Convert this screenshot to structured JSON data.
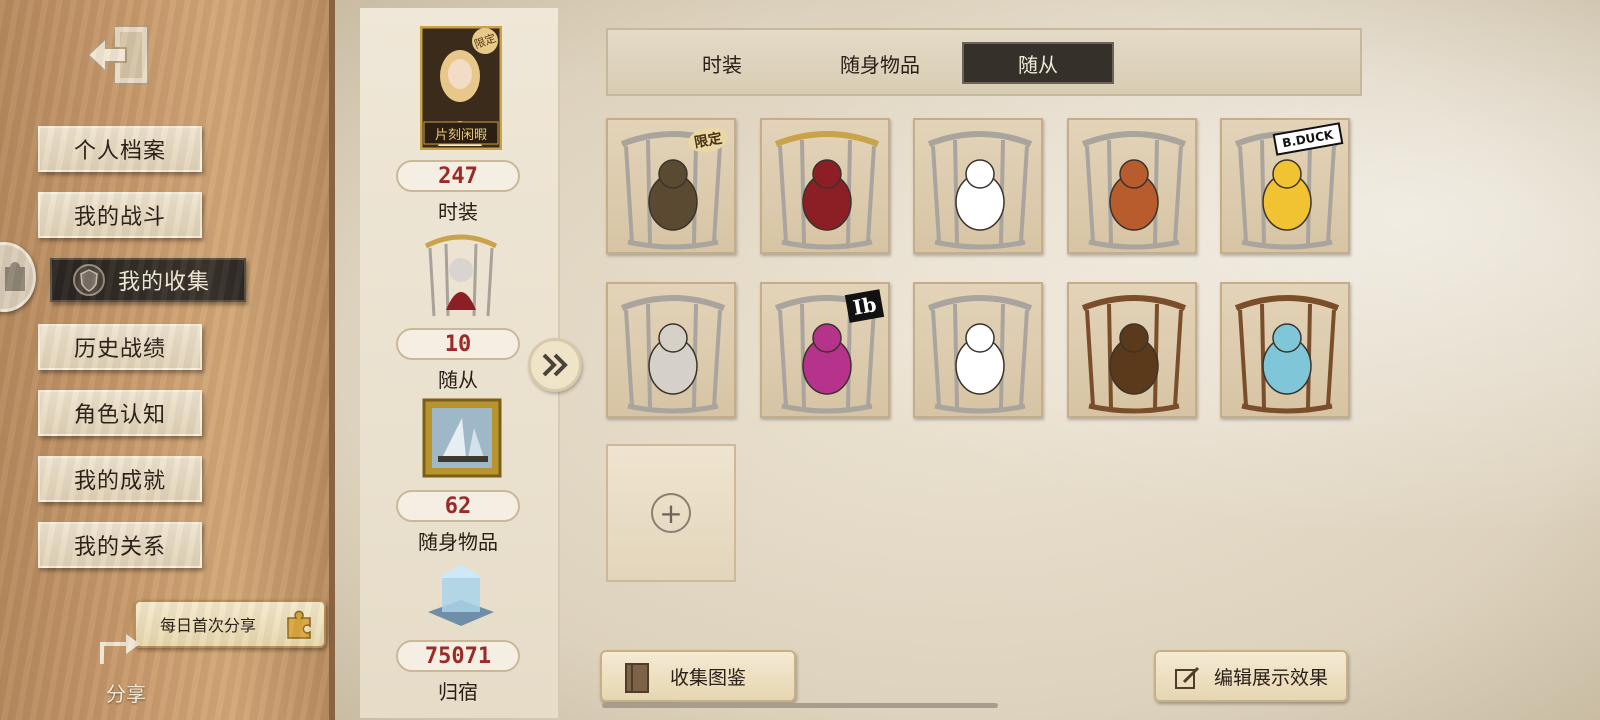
{
  "nav": {
    "items": [
      "个人档案",
      "我的战斗",
      "我的收集",
      "历史战绩",
      "角色认知",
      "我的成就",
      "我的关系"
    ],
    "active_index": 2,
    "share_daily": "每日首次分享",
    "share_label": "分享"
  },
  "summary": {
    "portrait_badge": "限定",
    "portrait_caption": "片刻闲暇",
    "items": [
      {
        "count": "247",
        "label": "时装"
      },
      {
        "count": "10",
        "label": "随从"
      },
      {
        "count": "62",
        "label": "随身物品"
      },
      {
        "count": "75071",
        "label": "归宿"
      }
    ]
  },
  "tabs": {
    "items": [
      "时装",
      "随身物品",
      "随从"
    ],
    "active_index": 2
  },
  "grid": {
    "cells": [
      {
        "name": "tree-creature-pet",
        "badge": "限定"
      },
      {
        "name": "doll-pet",
        "badge": ""
      },
      {
        "name": "cat-pet",
        "badge": ""
      },
      {
        "name": "squirrel-pet",
        "badge": ""
      },
      {
        "name": "duck-pet",
        "badge": "B.DUCK"
      },
      {
        "name": "elephant-pet",
        "badge": ""
      },
      {
        "name": "ib-doll-pet",
        "badge": "Ib"
      },
      {
        "name": "panda-pet",
        "badge": ""
      },
      {
        "name": "clock-pet",
        "badge": ""
      },
      {
        "name": "butterfly-pet",
        "badge": ""
      }
    ]
  },
  "bottom": {
    "collection_book": "收集图鉴",
    "edit_display": "编辑展示效果"
  },
  "colors": {
    "count_red": "#9b2a2a",
    "active_dark": "#35302a",
    "wood": "#c99a6c"
  }
}
